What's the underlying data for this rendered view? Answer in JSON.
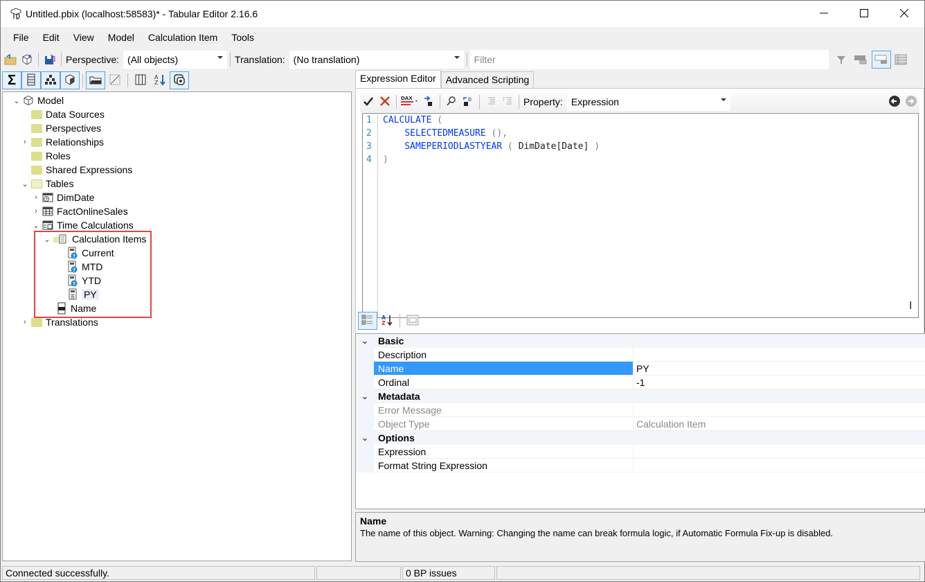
{
  "window": {
    "title": "Untitled.pbix (localhost:58583)* - Tabular Editor 2.16.6",
    "icons": {
      "app": "tabular-editor-icon",
      "minimize": "minimize-icon",
      "maximize": "maximize-icon",
      "close": "close-icon"
    }
  },
  "menu": [
    "File",
    "Edit",
    "View",
    "Model",
    "Calculation Item",
    "Tools"
  ],
  "toolbar": {
    "perspective_label": "Perspective:",
    "perspective_value": "(All objects)",
    "translation_label": "Translation:",
    "translation_value": "(No translation)",
    "filter_placeholder": "Filter"
  },
  "tree": {
    "items": [
      {
        "label": "Model",
        "icon": "model-icon",
        "expanded": true
      },
      {
        "label": "Data Sources",
        "icon": "folder-icon"
      },
      {
        "label": "Perspectives",
        "icon": "folder-icon"
      },
      {
        "label": "Relationships",
        "icon": "folder-icon",
        "expanded": false
      },
      {
        "label": "Roles",
        "icon": "folder-icon"
      },
      {
        "label": "Shared Expressions",
        "icon": "folder-icon"
      },
      {
        "label": "Tables",
        "icon": "folder-open-icon",
        "expanded": true
      },
      {
        "label": "DimDate",
        "icon": "date-table-icon",
        "expanded": false
      },
      {
        "label": "FactOnlineSales",
        "icon": "table-icon",
        "expanded": false
      },
      {
        "label": "Time Calculations",
        "icon": "calc-group-icon",
        "expanded": true
      },
      {
        "label": "Calculation Items",
        "icon": "calc-items-folder-icon",
        "expanded": true
      },
      {
        "label": "Current",
        "icon": "calc-item-warning-icon"
      },
      {
        "label": "MTD",
        "icon": "calc-item-warning-icon"
      },
      {
        "label": "YTD",
        "icon": "calc-item-warning-icon"
      },
      {
        "label": "PY",
        "icon": "calc-item-icon",
        "selected": true
      },
      {
        "label": "Name",
        "icon": "column-icon"
      },
      {
        "label": "Translations",
        "icon": "folder-icon",
        "expanded": false
      }
    ]
  },
  "editor": {
    "tabs": [
      "Expression Editor",
      "Advanced Scripting"
    ],
    "active_tab": "Expression Editor",
    "property_label": "Property:",
    "property_value": "Expression",
    "line_numbers": [
      "1",
      "2",
      "3",
      "4"
    ],
    "code": {
      "l1_fn": "CALCULATE",
      "l1_p": " (",
      "l2_indent": "    ",
      "l2_fn": "SELECTEDMEASURE",
      "l2_p": " (),",
      "l3_indent": "    ",
      "l3_fn": "SAMEPERIODLASTYEAR",
      "l3_p1": " ( ",
      "l3_ref": "DimDate[Date]",
      "l3_p2": " )",
      "l4_p": ")"
    }
  },
  "properties": {
    "categories": {
      "basic": "Basic",
      "metadata": "Metadata",
      "options": "Options"
    },
    "rows": {
      "description": {
        "name": "Description",
        "value": ""
      },
      "name": {
        "name": "Name",
        "value": "PY"
      },
      "ordinal": {
        "name": "Ordinal",
        "value": "-1"
      },
      "error_message": {
        "name": "Error Message",
        "value": ""
      },
      "object_type": {
        "name": "Object Type",
        "value": "Calculation Item"
      },
      "expression": {
        "name": "Expression",
        "value": ""
      },
      "format_string": {
        "name": "Format String Expression",
        "value": ""
      }
    },
    "description_title": "Name",
    "description_text": "The name of this object. Warning: Changing the name can break formula logic, if Automatic Formula Fix-up is disabled."
  },
  "status": {
    "message": "Connected successfully.",
    "bp_issues": "0 BP issues"
  },
  "colors": {
    "highlight_box": "#e84141",
    "selection": "#3399ff",
    "dax_keyword": "#0035ff"
  }
}
